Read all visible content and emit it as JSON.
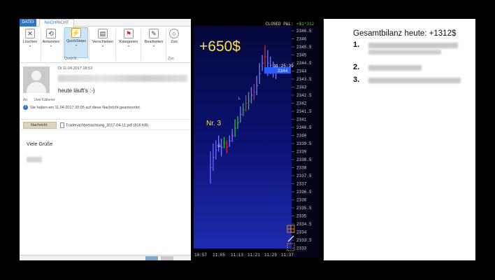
{
  "outlook": {
    "tabs": {
      "file": "DATEI",
      "message": "NACHRICHT"
    },
    "ribbon": {
      "buttons": [
        {
          "label": "Löschen",
          "icon": "delete-x-icon"
        },
        {
          "label": "Antworten",
          "icon": "reply-icon"
        },
        {
          "label": "QuickSteps",
          "icon": "lightning-icon"
        },
        {
          "label": "Verschieben",
          "icon": "move-folder-icon"
        },
        {
          "label": "Kategorien",
          "icon": "flag-icon"
        },
        {
          "label": "Bearbeiten",
          "icon": "edit-icon"
        },
        {
          "label": "Zoo",
          "icon": "zoom-icon"
        }
      ],
      "group_quicksteps": "QuickSt...",
      "group_zoom": "Zoo"
    },
    "message": {
      "date": "Di 11.04.2017 18:53",
      "subject": "heute läuft's :-)",
      "to_label": "An",
      "to_value": "Uwe Kälberer",
      "info": "Sie haben am 11.04.2017 20:05 auf diese Nachricht geantwortet.",
      "attachment_message": "Nachricht",
      "attachment_file": "Tradenachbetrachtung_2017-04-11.pdf (816 KB)",
      "body": "Viele Grüße"
    }
  },
  "chart": {
    "header": "CLOSED P&L:",
    "header_value": "+$1*312",
    "profit": "+650$",
    "trade_label": "Nr. 3",
    "time_display": "11:25:39",
    "price_display": "2344",
    "price_labels": [
      "2346.5",
      "2346",
      "2345.5",
      "2345",
      "2344.5",
      "2344",
      "2343.5",
      "2343",
      "2342.5",
      "2342",
      "2341.5",
      "2341",
      "2340.5",
      "2340",
      "2339.5",
      "2339",
      "2338.5",
      "2338",
      "2337.5",
      "2337",
      "2336.5",
      "2336",
      "2335.5",
      "2335",
      "2334.5",
      "2334",
      "2333.5",
      "2333"
    ],
    "time_labels": [
      "10:57",
      "11:05",
      "11:13",
      "11:21",
      "11:29",
      "11:37"
    ],
    "marker_sl": "SL",
    "marker_l": "L"
  },
  "summary": {
    "title": "Gesamtbilanz heute: +1312$",
    "items": [
      {
        "num": "1."
      },
      {
        "num": "2."
      },
      {
        "num": "3."
      }
    ]
  }
}
